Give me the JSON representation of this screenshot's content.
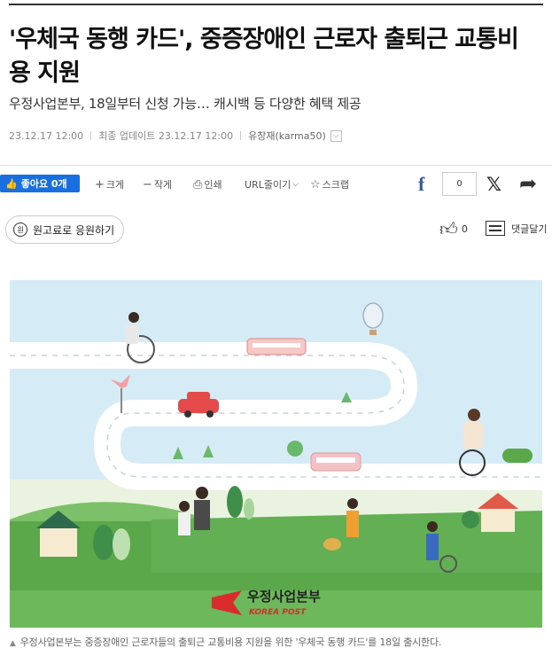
{
  "article": {
    "headline": "'우체국 동행 카드', 중증장애인 근로자 출퇴근 교통비 용 지원",
    "subtitle": "우정사업본부, 18일부터 신청 가능… 캐시백 등 다양한 혜택 제공",
    "published": "23.12.17 12:00",
    "updated_label": "최종 업데이트",
    "updated": "23.12.17 12:00",
    "author": "유창재(karma50)"
  },
  "toolbar": {
    "like_label": "좋아요 0개",
    "font_bigger": "크게",
    "font_smaller": "작게",
    "print": "인쇄",
    "url_shorten": "URL줄이기",
    "scrap": "스크랩",
    "share_count": "0"
  },
  "engagement": {
    "support_label": "원고료로 응원하기",
    "recommend_count": "0",
    "comment_label": "댓글달기"
  },
  "figure": {
    "logo_text": "우정사업본부",
    "logo_subtext": "KOREA POST",
    "caption": "우정사업본부는 중증장애인 근로자들의 출퇴근 교통비용 지원을 위한 '우체국 동행 카드'를 18일 출시한다."
  },
  "colors": {
    "like_button": "#1a6fe0",
    "sky": "#cfe6f3",
    "grass": "#5aa84a",
    "road": "#ffffff",
    "logo_red": "#d92b2b"
  }
}
